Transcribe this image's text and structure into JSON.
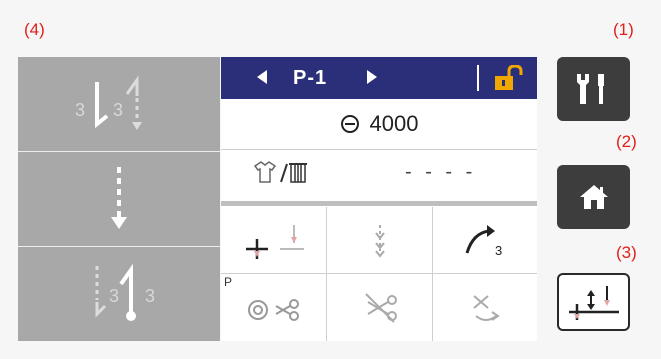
{
  "callouts": {
    "c1": "(1)",
    "c2": "(2)",
    "c3": "(3)",
    "c4": "(4)"
  },
  "program": {
    "name": "P-1",
    "prev_icon": "left-triangle-icon",
    "next_icon": "right-triangle-icon",
    "lock_icon": "unlocked-padlock-icon"
  },
  "counter": {
    "icon": "counter-dial-icon",
    "value": "4000"
  },
  "garment": {
    "icon": "shirt-bobbin-icon",
    "value": "- - - -"
  },
  "left_panel": {
    "top_left_digit": "3",
    "top_right_digit": "3",
    "bottom_left_digit": "3",
    "bottom_right_digit": "3"
  },
  "grid": {
    "p_label": "P",
    "loop_num": "3"
  },
  "buttons": {
    "settings_icon": "wrench-screwdriver-icon",
    "home_icon": "home-icon",
    "presser_icon": "needle-up-down-icon"
  },
  "colors": {
    "bar": "#2b2e78",
    "lock": "#f0a800",
    "callout": "#e0201a",
    "dark_button": "#3d3d3d"
  }
}
